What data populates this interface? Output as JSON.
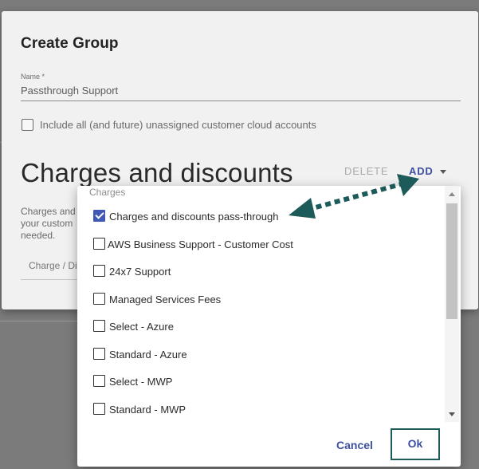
{
  "create_group": {
    "title": "Create Group",
    "name_label": "Name *",
    "name_value": "Passthrough Support",
    "include_checkbox_label": "Include all (and future) unassigned customer cloud accounts",
    "include_checked": false,
    "section_heading": "Charges and discounts",
    "delete_label": "DELETE",
    "add_label": "ADD",
    "description_lines": [
      "Charges and",
      "your custom",
      "needed."
    ],
    "column_header": "Charge / Di"
  },
  "charges_panel": {
    "title": "Charges",
    "options": [
      {
        "label": "Charges and discounts pass-through",
        "checked": true
      },
      {
        "label": "AWS Business Support - Customer Cost",
        "checked": false
      },
      {
        "label": "24x7 Support",
        "checked": false
      },
      {
        "label": "Managed Services Fees",
        "checked": false
      },
      {
        "label": "Select - Azure",
        "checked": false
      },
      {
        "label": "Standard - Azure",
        "checked": false
      },
      {
        "label": "Select - MWP",
        "checked": false
      },
      {
        "label": "Standard - MWP",
        "checked": false
      }
    ],
    "cancel_label": "Cancel",
    "ok_label": "Ok"
  },
  "colors": {
    "accent": "#3d4fa1",
    "checkbox_checked": "#4158b4",
    "annotation": "#1d5a5a",
    "overlay": "#7b7b7b"
  },
  "icons": [
    "chevron-down-icon",
    "check-icon",
    "scroll-up-icon",
    "scroll-down-icon",
    "double-arrow-annotation-icon"
  ]
}
